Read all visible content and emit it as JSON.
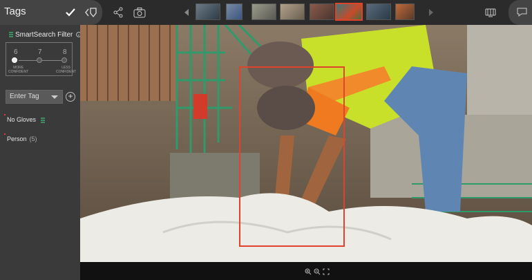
{
  "app": {
    "title": "Tags"
  },
  "toolbar": {
    "confirm_icon": "check-icon",
    "back_icon": "back-tag-icon",
    "share_icon": "share-icon",
    "camera_icon": "camera-icon",
    "prev_icon": "prev-arrow-icon",
    "next_icon": "next-arrow-icon",
    "viewer_icon": "viewer-icon",
    "chat_icon": "comment-icon"
  },
  "thumbnails": [
    {
      "selected": false,
      "color": "#6b7a86"
    },
    {
      "selected": false,
      "color": "#4a6a9a"
    },
    {
      "selected": false,
      "color": "#8a8a7a"
    },
    {
      "selected": false,
      "color": "#9a8a7a"
    },
    {
      "selected": false,
      "color": "#7a5a4a"
    },
    {
      "selected": true,
      "color": "#3a6a8a"
    },
    {
      "selected": false,
      "color": "#5a6a7a"
    },
    {
      "selected": false,
      "color": "#8a5a3a"
    }
  ],
  "smartsearch": {
    "title": "SmartSearch Filter",
    "levels": [
      "6",
      "7",
      "8"
    ],
    "more_label_1": "MORE",
    "more_label_2": "CONFIDENT",
    "less_label_1": "LESS",
    "less_label_2": "CONFIDENT",
    "selected_level": "6"
  },
  "tag_input": {
    "placeholder": "Enter Tag"
  },
  "tags": [
    {
      "label": "No Gloves",
      "count": ""
    },
    {
      "label": "Person",
      "count": "(5)"
    }
  ],
  "colors": {
    "accent": "#e0432c",
    "sidebar": "#3a3a3a",
    "topbar": "#2b2b2b"
  }
}
